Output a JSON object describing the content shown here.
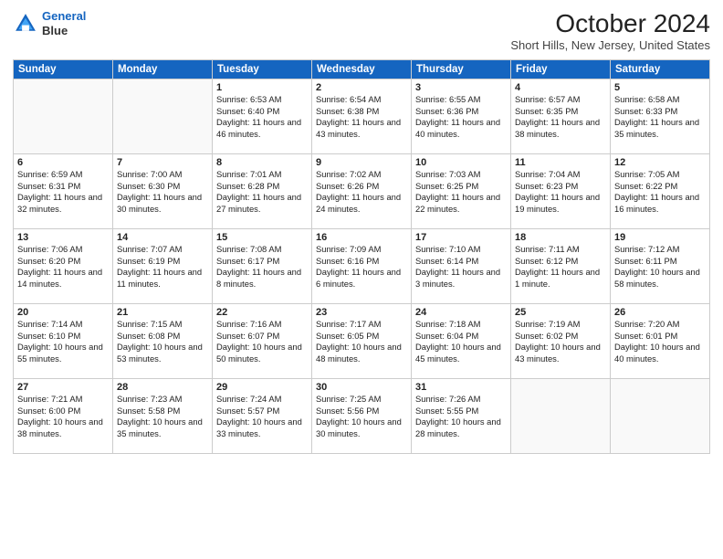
{
  "header": {
    "logo": {
      "line1": "General",
      "line2": "Blue"
    },
    "title": "October 2024",
    "location": "Short Hills, New Jersey, United States"
  },
  "days_of_week": [
    "Sunday",
    "Monday",
    "Tuesday",
    "Wednesday",
    "Thursday",
    "Friday",
    "Saturday"
  ],
  "weeks": [
    [
      {
        "day": "",
        "info": ""
      },
      {
        "day": "",
        "info": ""
      },
      {
        "day": "1",
        "info": "Sunrise: 6:53 AM\nSunset: 6:40 PM\nDaylight: 11 hours and 46 minutes."
      },
      {
        "day": "2",
        "info": "Sunrise: 6:54 AM\nSunset: 6:38 PM\nDaylight: 11 hours and 43 minutes."
      },
      {
        "day": "3",
        "info": "Sunrise: 6:55 AM\nSunset: 6:36 PM\nDaylight: 11 hours and 40 minutes."
      },
      {
        "day": "4",
        "info": "Sunrise: 6:57 AM\nSunset: 6:35 PM\nDaylight: 11 hours and 38 minutes."
      },
      {
        "day": "5",
        "info": "Sunrise: 6:58 AM\nSunset: 6:33 PM\nDaylight: 11 hours and 35 minutes."
      }
    ],
    [
      {
        "day": "6",
        "info": "Sunrise: 6:59 AM\nSunset: 6:31 PM\nDaylight: 11 hours and 32 minutes."
      },
      {
        "day": "7",
        "info": "Sunrise: 7:00 AM\nSunset: 6:30 PM\nDaylight: 11 hours and 30 minutes."
      },
      {
        "day": "8",
        "info": "Sunrise: 7:01 AM\nSunset: 6:28 PM\nDaylight: 11 hours and 27 minutes."
      },
      {
        "day": "9",
        "info": "Sunrise: 7:02 AM\nSunset: 6:26 PM\nDaylight: 11 hours and 24 minutes."
      },
      {
        "day": "10",
        "info": "Sunrise: 7:03 AM\nSunset: 6:25 PM\nDaylight: 11 hours and 22 minutes."
      },
      {
        "day": "11",
        "info": "Sunrise: 7:04 AM\nSunset: 6:23 PM\nDaylight: 11 hours and 19 minutes."
      },
      {
        "day": "12",
        "info": "Sunrise: 7:05 AM\nSunset: 6:22 PM\nDaylight: 11 hours and 16 minutes."
      }
    ],
    [
      {
        "day": "13",
        "info": "Sunrise: 7:06 AM\nSunset: 6:20 PM\nDaylight: 11 hours and 14 minutes."
      },
      {
        "day": "14",
        "info": "Sunrise: 7:07 AM\nSunset: 6:19 PM\nDaylight: 11 hours and 11 minutes."
      },
      {
        "day": "15",
        "info": "Sunrise: 7:08 AM\nSunset: 6:17 PM\nDaylight: 11 hours and 8 minutes."
      },
      {
        "day": "16",
        "info": "Sunrise: 7:09 AM\nSunset: 6:16 PM\nDaylight: 11 hours and 6 minutes."
      },
      {
        "day": "17",
        "info": "Sunrise: 7:10 AM\nSunset: 6:14 PM\nDaylight: 11 hours and 3 minutes."
      },
      {
        "day": "18",
        "info": "Sunrise: 7:11 AM\nSunset: 6:12 PM\nDaylight: 11 hours and 1 minute."
      },
      {
        "day": "19",
        "info": "Sunrise: 7:12 AM\nSunset: 6:11 PM\nDaylight: 10 hours and 58 minutes."
      }
    ],
    [
      {
        "day": "20",
        "info": "Sunrise: 7:14 AM\nSunset: 6:10 PM\nDaylight: 10 hours and 55 minutes."
      },
      {
        "day": "21",
        "info": "Sunrise: 7:15 AM\nSunset: 6:08 PM\nDaylight: 10 hours and 53 minutes."
      },
      {
        "day": "22",
        "info": "Sunrise: 7:16 AM\nSunset: 6:07 PM\nDaylight: 10 hours and 50 minutes."
      },
      {
        "day": "23",
        "info": "Sunrise: 7:17 AM\nSunset: 6:05 PM\nDaylight: 10 hours and 48 minutes."
      },
      {
        "day": "24",
        "info": "Sunrise: 7:18 AM\nSunset: 6:04 PM\nDaylight: 10 hours and 45 minutes."
      },
      {
        "day": "25",
        "info": "Sunrise: 7:19 AM\nSunset: 6:02 PM\nDaylight: 10 hours and 43 minutes."
      },
      {
        "day": "26",
        "info": "Sunrise: 7:20 AM\nSunset: 6:01 PM\nDaylight: 10 hours and 40 minutes."
      }
    ],
    [
      {
        "day": "27",
        "info": "Sunrise: 7:21 AM\nSunset: 6:00 PM\nDaylight: 10 hours and 38 minutes."
      },
      {
        "day": "28",
        "info": "Sunrise: 7:23 AM\nSunset: 5:58 PM\nDaylight: 10 hours and 35 minutes."
      },
      {
        "day": "29",
        "info": "Sunrise: 7:24 AM\nSunset: 5:57 PM\nDaylight: 10 hours and 33 minutes."
      },
      {
        "day": "30",
        "info": "Sunrise: 7:25 AM\nSunset: 5:56 PM\nDaylight: 10 hours and 30 minutes."
      },
      {
        "day": "31",
        "info": "Sunrise: 7:26 AM\nSunset: 5:55 PM\nDaylight: 10 hours and 28 minutes."
      },
      {
        "day": "",
        "info": ""
      },
      {
        "day": "",
        "info": ""
      }
    ]
  ]
}
